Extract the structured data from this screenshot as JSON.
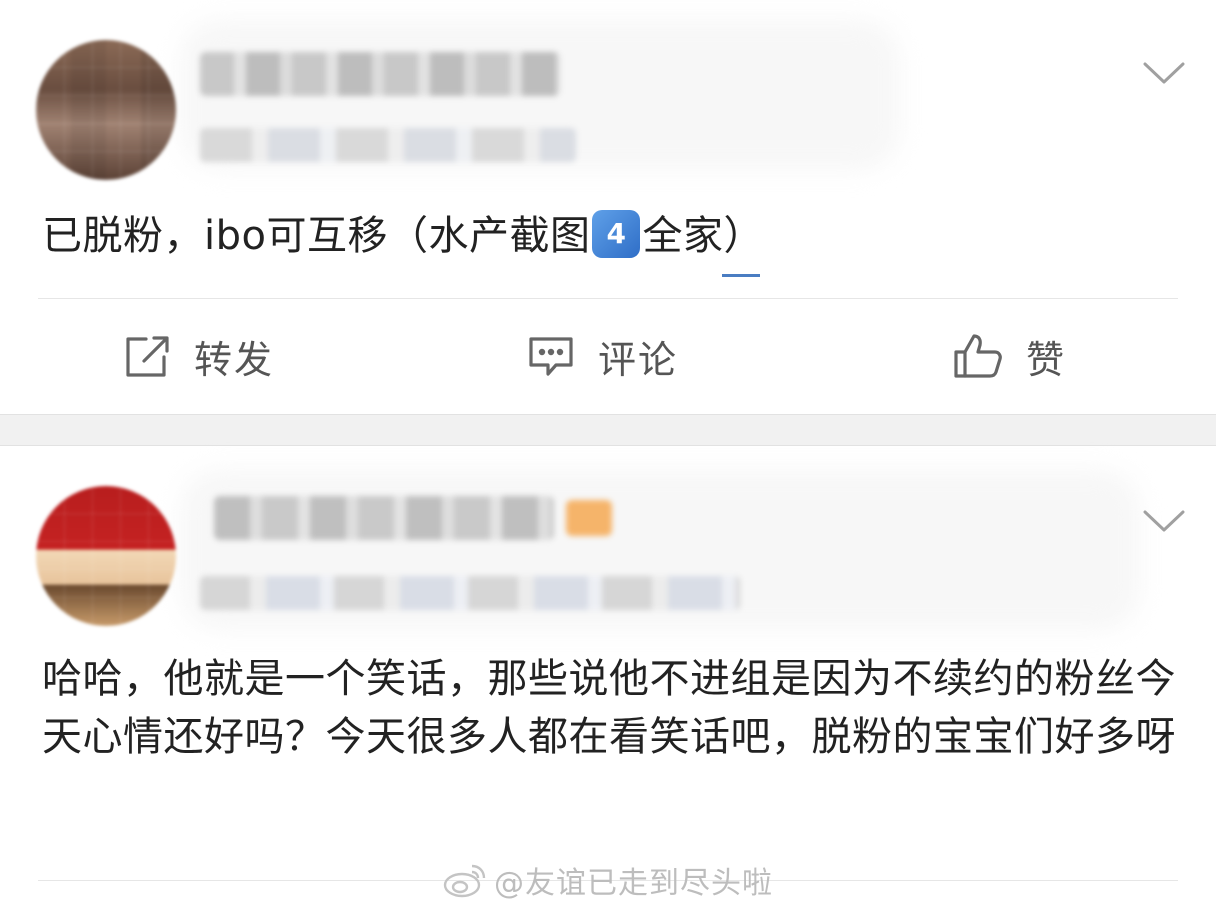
{
  "posts": [
    {
      "text_before_emoji": "已脱粉，ibo可互移（水产截图",
      "emoji": "4",
      "text_after_emoji": "全家）",
      "actions": {
        "repost": "转发",
        "comment": "评论",
        "like": "赞"
      }
    },
    {
      "text": "哈哈，他就是一个笑话，那些说他不进组是因为不续约的粉丝今天心情还好吗？今天很多人都在看笑话吧，脱粉的宝宝们好多呀"
    }
  ],
  "watermark": {
    "text": "@友谊已走到尽头啦"
  },
  "icons": [
    "chevron-down-icon",
    "repost-icon",
    "comment-icon",
    "like-icon",
    "weibo-logo-icon"
  ],
  "colors": {
    "text": "#222222",
    "action": "#555555",
    "separator": "#f1f1f1",
    "watermark": "#bdbdbd"
  }
}
